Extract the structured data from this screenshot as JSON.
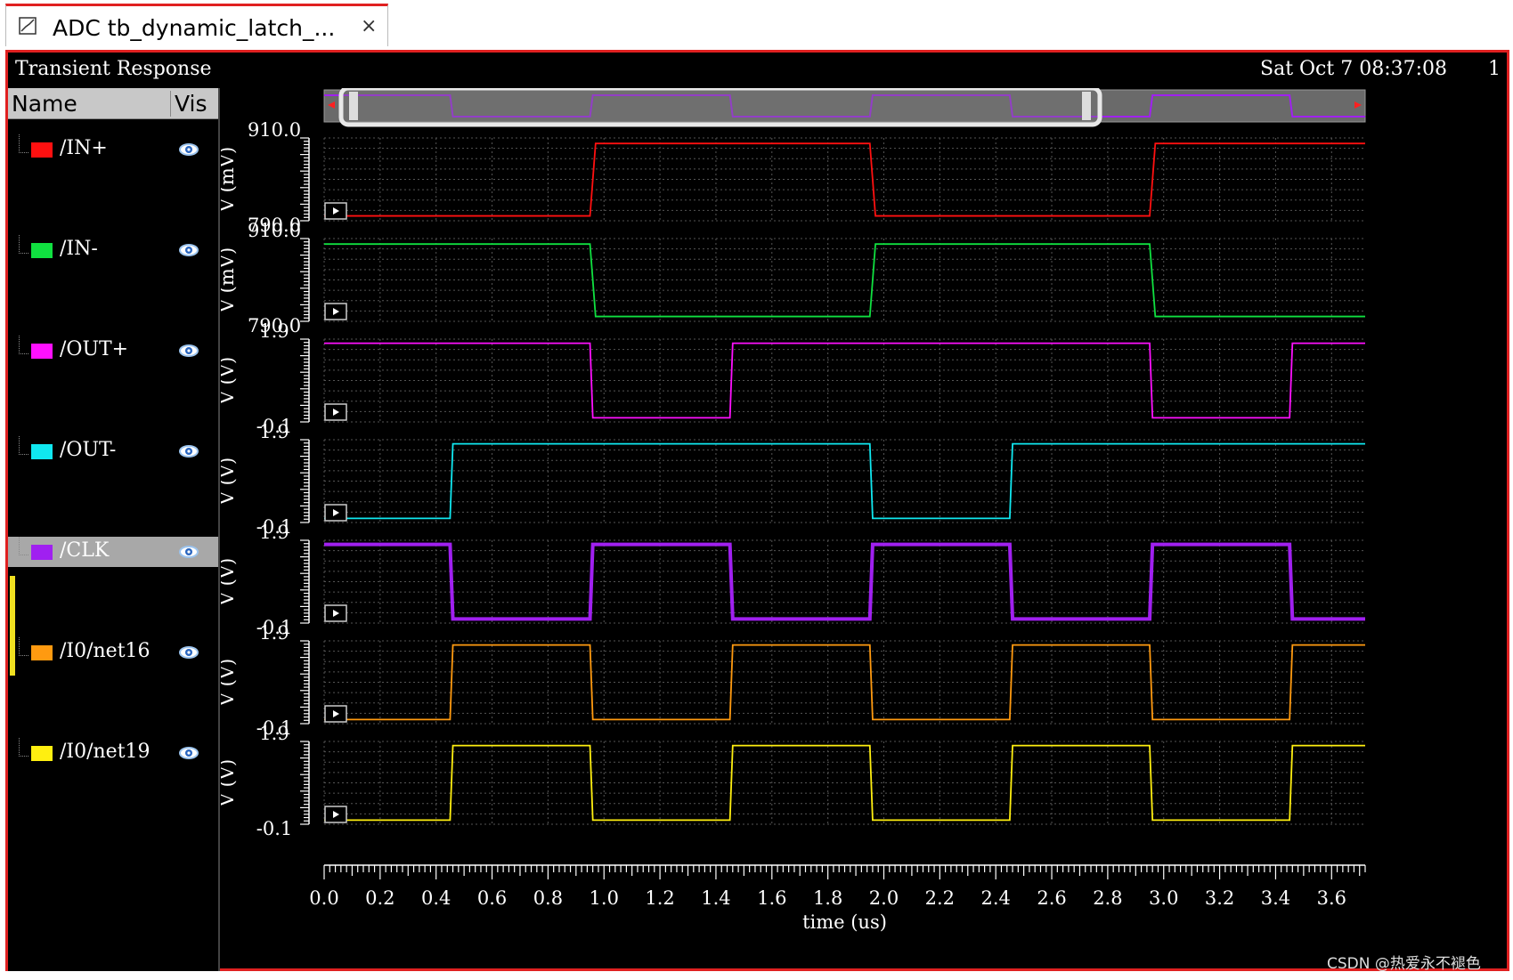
{
  "tab": {
    "title": "ADC tb_dynamic_latch_...",
    "close": "×"
  },
  "header": {
    "title": "Transient Response",
    "date": "Sat Oct  7 08:37:08",
    "page_number": "1"
  },
  "panel": {
    "col_name": "Name",
    "col_vis": "Vis"
  },
  "signals": [
    {
      "label": "/IN+",
      "color": "#ff1010",
      "selected": false
    },
    {
      "label": "/IN-",
      "color": "#10e040",
      "selected": false
    },
    {
      "label": "/OUT+",
      "color": "#ff10ff",
      "selected": false
    },
    {
      "label": "/OUT-",
      "color": "#10e8f0",
      "selected": false
    },
    {
      "label": "/CLK",
      "color": "#a020f0",
      "selected": true
    },
    {
      "label": "/I0/net16",
      "color": "#ff9a10",
      "selected": false
    },
    {
      "label": "/I0/net19",
      "color": "#ffef10",
      "selected": false
    }
  ],
  "strips": [
    {
      "ylabel": "V (mV)",
      "ymax": "910.0",
      "ymin": "790.0"
    },
    {
      "ylabel": "V (mV)",
      "ymax": "910.0",
      "ymin": "790.0"
    },
    {
      "ylabel": "V (V)",
      "ymax": "1.9",
      "ymin": "-0.1"
    },
    {
      "ylabel": "V (V)",
      "ymax": "1.9",
      "ymin": "-0.1"
    },
    {
      "ylabel": "V (V)",
      "ymax": "1.9",
      "ymin": "-0.1"
    },
    {
      "ylabel": "V (V)",
      "ymax": "1.9",
      "ymin": "-0.1"
    },
    {
      "ylabel": "V (V)",
      "ymax": "1.9",
      "ymin": "-0.1"
    }
  ],
  "chart_data": {
    "type": "line",
    "xlabel": "time (us)",
    "xlim": [
      0.0,
      3.72
    ],
    "x_ticks": [
      "0.0",
      "0.2",
      "0.4",
      "0.6",
      "0.8",
      "1.0",
      "1.2",
      "1.4",
      "1.6",
      "1.8",
      "2.0",
      "2.2",
      "2.4",
      "2.6",
      "2.8",
      "3.0",
      "3.2",
      "3.4",
      "3.6"
    ],
    "grid": true,
    "series": [
      {
        "name": "/IN+",
        "color": "#ff1010",
        "ylim": [
          790.0,
          910.0
        ],
        "x": [
          0,
          0.95,
          0.97,
          1.95,
          1.97,
          2.95,
          2.97,
          3.72
        ],
        "y": [
          797,
          797,
          902,
          902,
          797,
          797,
          902,
          902
        ]
      },
      {
        "name": "/IN-",
        "color": "#10e040",
        "ylim": [
          790.0,
          910.0
        ],
        "x": [
          0,
          0.95,
          0.97,
          1.95,
          1.97,
          2.95,
          2.97,
          3.72
        ],
        "y": [
          902,
          902,
          797,
          797,
          902,
          902,
          797,
          797
        ]
      },
      {
        "name": "/OUT+",
        "color": "#ff10ff",
        "ylim": [
          -0.1,
          1.9
        ],
        "x": [
          0,
          0.95,
          0.96,
          1.45,
          1.46,
          2.95,
          2.96,
          3.45,
          3.46,
          3.72
        ],
        "y": [
          1.8,
          1.8,
          0.0,
          0.0,
          1.8,
          1.8,
          0.0,
          0.0,
          1.8,
          1.8
        ]
      },
      {
        "name": "/OUT-",
        "color": "#10e8f0",
        "ylim": [
          -0.1,
          1.9
        ],
        "x": [
          0,
          0.45,
          0.46,
          1.95,
          1.96,
          2.45,
          2.46,
          3.72
        ],
        "y": [
          0.0,
          0.0,
          1.8,
          1.8,
          0.0,
          0.0,
          1.8,
          1.8
        ]
      },
      {
        "name": "/CLK",
        "color": "#a020f0",
        "ylim": [
          -0.1,
          1.9
        ],
        "x": [
          0,
          0.45,
          0.46,
          0.95,
          0.96,
          1.45,
          1.46,
          1.95,
          1.96,
          2.45,
          2.46,
          2.95,
          2.96,
          3.45,
          3.46,
          3.72
        ],
        "y": [
          1.8,
          1.8,
          0.0,
          0.0,
          1.8,
          1.8,
          0.0,
          0.0,
          1.8,
          1.8,
          0.0,
          0.0,
          1.8,
          1.8,
          0.0,
          0.0
        ]
      },
      {
        "name": "/I0/net16",
        "color": "#ff9a10",
        "ylim": [
          -0.1,
          1.9
        ],
        "x": [
          0,
          0.45,
          0.46,
          0.95,
          0.96,
          1.45,
          1.46,
          1.95,
          1.96,
          2.45,
          2.46,
          2.95,
          2.96,
          3.45,
          3.46,
          3.72
        ],
        "y": [
          0.0,
          0.0,
          1.8,
          1.8,
          0.0,
          0.0,
          1.8,
          1.8,
          0.0,
          0.0,
          1.8,
          1.8,
          0.0,
          0.0,
          1.8,
          1.8
        ]
      },
      {
        "name": "/I0/net19",
        "color": "#ffef10",
        "ylim": [
          -0.1,
          1.9
        ],
        "x": [
          0,
          0.45,
          0.46,
          0.95,
          0.96,
          1.45,
          1.46,
          1.95,
          1.96,
          2.45,
          2.46,
          2.95,
          2.96,
          3.45,
          3.46,
          3.72
        ],
        "y": [
          0.0,
          0.0,
          1.8,
          1.8,
          0.0,
          0.0,
          1.8,
          1.8,
          0.0,
          0.0,
          1.8,
          1.8,
          0.0,
          0.0,
          1.8,
          1.8
        ]
      }
    ]
  },
  "watermark": "CSDN @热爱永不褪色"
}
